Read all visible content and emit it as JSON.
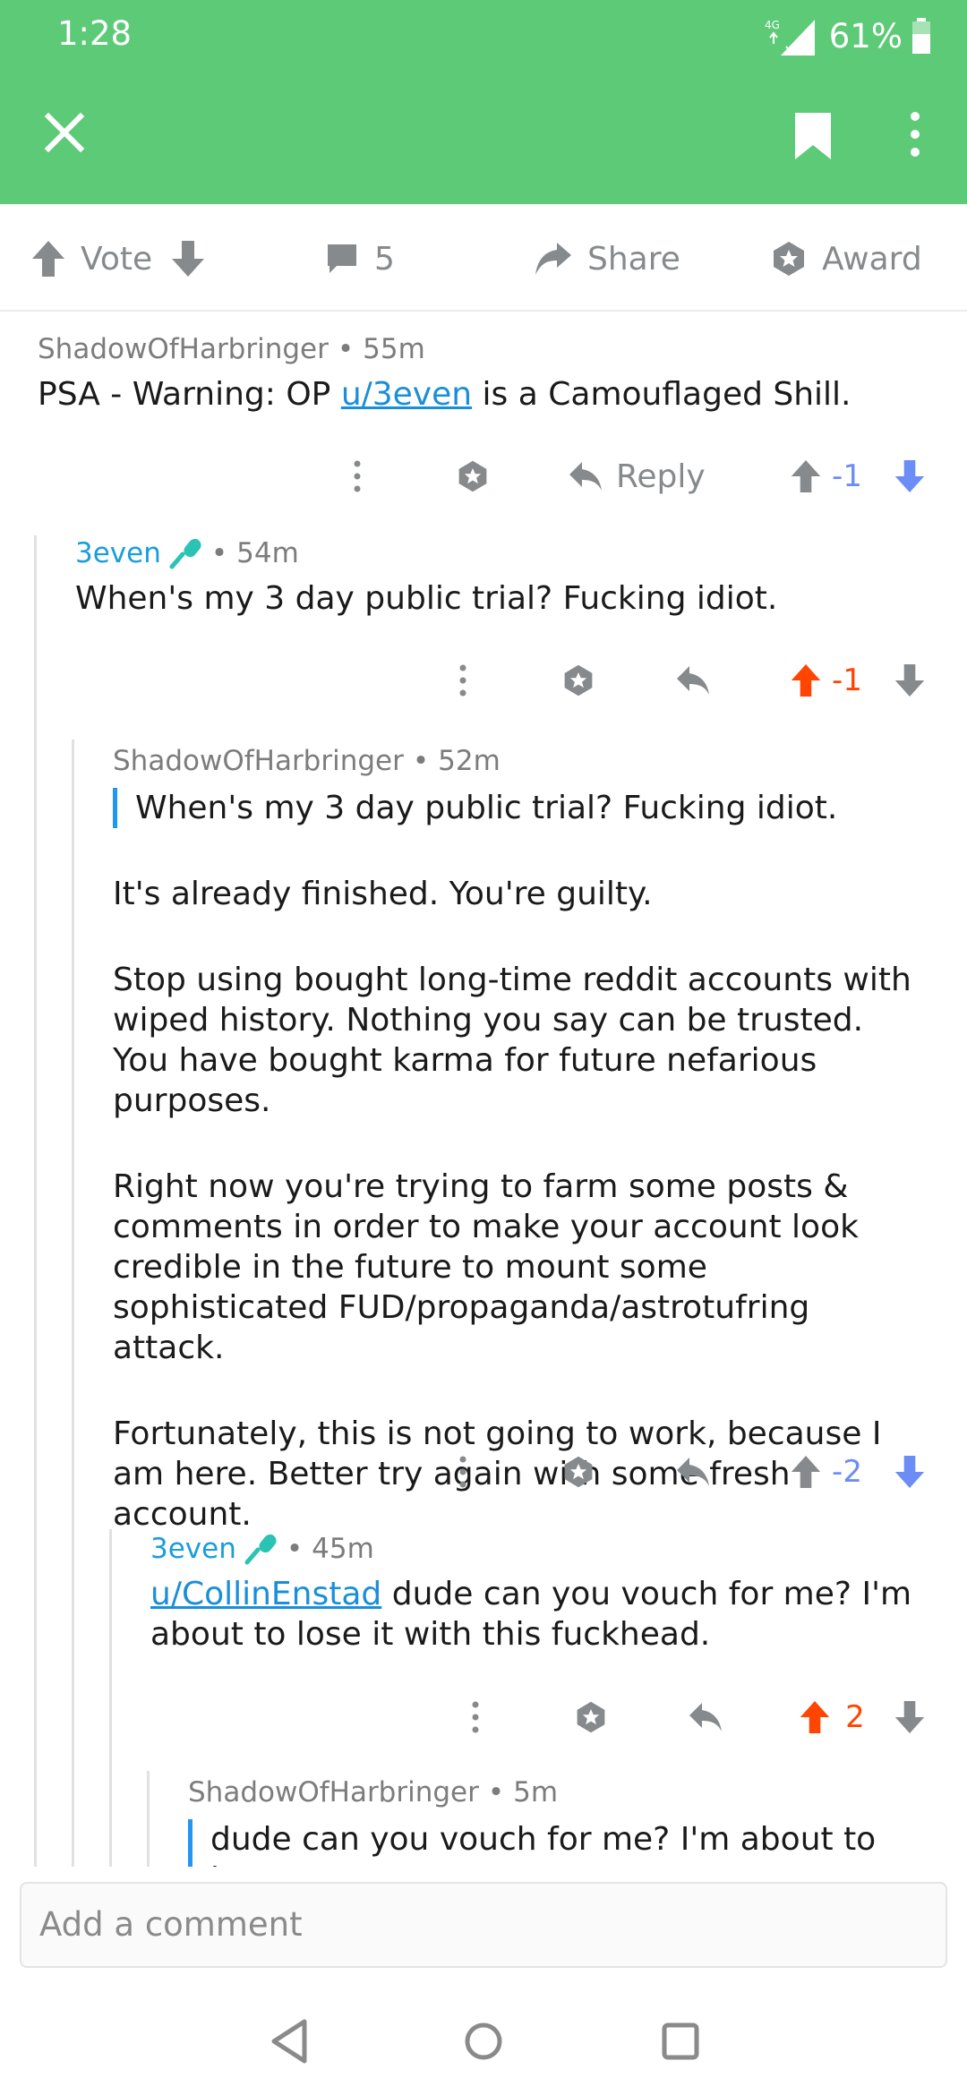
{
  "status_bar": {
    "time": "1:28",
    "network": "4G",
    "battery": "61%"
  },
  "app_bar": {
    "icons": [
      "close-icon",
      "bookmark-icon",
      "more-vert-icon"
    ]
  },
  "action_bar": {
    "vote_label": "Vote",
    "comment_count": "5",
    "share_label": "Share",
    "award_label": "Award"
  },
  "comments": [
    {
      "author": "ShadowOfHarbringer",
      "time": "55m",
      "text_before": "PSA - Warning: OP ",
      "link": "u/3even",
      "text_after": " is a Camouflaged Shill.",
      "reply_label": "Reply",
      "score": "-1",
      "vote_state": "down"
    },
    {
      "author": "3even",
      "time": "54m",
      "text": "When's my 3 day public trial? Fucking idiot.",
      "score": "-1",
      "vote_state": "up"
    },
    {
      "author": "ShadowOfHarbringer",
      "time": "52m",
      "quote": "When's my 3 day public trial? Fucking idiot.",
      "paragraphs": [
        "It's already finished. You're guilty.",
        "Stop using bought long-time reddit accounts with wiped history. Nothing you say can be trusted. You have bought karma for future nefarious purposes.",
        "Right now you're trying to farm some posts & comments in order to make your account look credible in the future to mount some sophisticated FUD/propaganda/astrotufring attack.",
        "Fortunately, this is not going to work, because I am here. Better try again with some fresh account."
      ],
      "score": "-2",
      "vote_state": "down"
    },
    {
      "author": "3even",
      "time": "45m",
      "link": "u/CollinEnstad",
      "text_after": " dude can you vouch for me? I'm about to lose it with this fuckhead.",
      "score": "2",
      "vote_state": "up"
    },
    {
      "author": "ShadowOfHarbringer",
      "time": "5m",
      "quote": "dude can you vouch for me? I'm about to lose"
    }
  ],
  "composer": {
    "placeholder": "Add a comment"
  },
  "colors": {
    "app_bar": "#5DCA77",
    "upvote": "#FF4500",
    "downvote": "#6C8CF6",
    "op": "#1A9EDB",
    "link": "#1A8FD8"
  }
}
